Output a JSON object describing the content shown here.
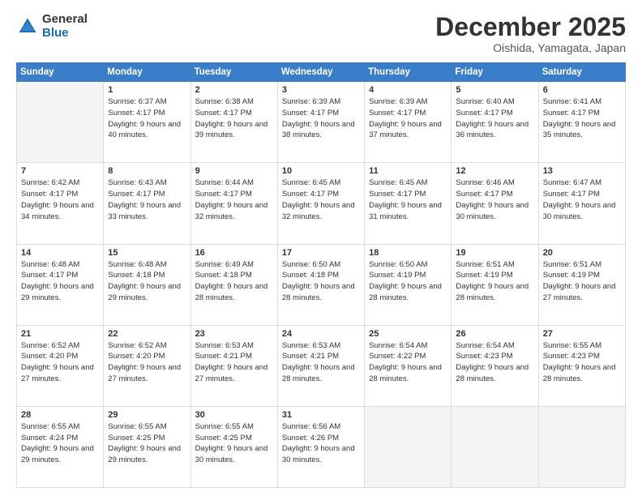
{
  "logo": {
    "general": "General",
    "blue": "Blue"
  },
  "header": {
    "month": "December 2025",
    "location": "Oishida, Yamagata, Japan"
  },
  "days_of_week": [
    "Sunday",
    "Monday",
    "Tuesday",
    "Wednesday",
    "Thursday",
    "Friday",
    "Saturday"
  ],
  "weeks": [
    [
      {
        "day": "",
        "sunrise": "",
        "sunset": "",
        "daylight": ""
      },
      {
        "day": "1",
        "sunrise": "Sunrise: 6:37 AM",
        "sunset": "Sunset: 4:17 PM",
        "daylight": "Daylight: 9 hours and 40 minutes."
      },
      {
        "day": "2",
        "sunrise": "Sunrise: 6:38 AM",
        "sunset": "Sunset: 4:17 PM",
        "daylight": "Daylight: 9 hours and 39 minutes."
      },
      {
        "day": "3",
        "sunrise": "Sunrise: 6:39 AM",
        "sunset": "Sunset: 4:17 PM",
        "daylight": "Daylight: 9 hours and 38 minutes."
      },
      {
        "day": "4",
        "sunrise": "Sunrise: 6:39 AM",
        "sunset": "Sunset: 4:17 PM",
        "daylight": "Daylight: 9 hours and 37 minutes."
      },
      {
        "day": "5",
        "sunrise": "Sunrise: 6:40 AM",
        "sunset": "Sunset: 4:17 PM",
        "daylight": "Daylight: 9 hours and 36 minutes."
      },
      {
        "day": "6",
        "sunrise": "Sunrise: 6:41 AM",
        "sunset": "Sunset: 4:17 PM",
        "daylight": "Daylight: 9 hours and 35 minutes."
      }
    ],
    [
      {
        "day": "7",
        "sunrise": "Sunrise: 6:42 AM",
        "sunset": "Sunset: 4:17 PM",
        "daylight": "Daylight: 9 hours and 34 minutes."
      },
      {
        "day": "8",
        "sunrise": "Sunrise: 6:43 AM",
        "sunset": "Sunset: 4:17 PM",
        "daylight": "Daylight: 9 hours and 33 minutes."
      },
      {
        "day": "9",
        "sunrise": "Sunrise: 6:44 AM",
        "sunset": "Sunset: 4:17 PM",
        "daylight": "Daylight: 9 hours and 32 minutes."
      },
      {
        "day": "10",
        "sunrise": "Sunrise: 6:45 AM",
        "sunset": "Sunset: 4:17 PM",
        "daylight": "Daylight: 9 hours and 32 minutes."
      },
      {
        "day": "11",
        "sunrise": "Sunrise: 6:45 AM",
        "sunset": "Sunset: 4:17 PM",
        "daylight": "Daylight: 9 hours and 31 minutes."
      },
      {
        "day": "12",
        "sunrise": "Sunrise: 6:46 AM",
        "sunset": "Sunset: 4:17 PM",
        "daylight": "Daylight: 9 hours and 30 minutes."
      },
      {
        "day": "13",
        "sunrise": "Sunrise: 6:47 AM",
        "sunset": "Sunset: 4:17 PM",
        "daylight": "Daylight: 9 hours and 30 minutes."
      }
    ],
    [
      {
        "day": "14",
        "sunrise": "Sunrise: 6:48 AM",
        "sunset": "Sunset: 4:17 PM",
        "daylight": "Daylight: 9 hours and 29 minutes."
      },
      {
        "day": "15",
        "sunrise": "Sunrise: 6:48 AM",
        "sunset": "Sunset: 4:18 PM",
        "daylight": "Daylight: 9 hours and 29 minutes."
      },
      {
        "day": "16",
        "sunrise": "Sunrise: 6:49 AM",
        "sunset": "Sunset: 4:18 PM",
        "daylight": "Daylight: 9 hours and 28 minutes."
      },
      {
        "day": "17",
        "sunrise": "Sunrise: 6:50 AM",
        "sunset": "Sunset: 4:18 PM",
        "daylight": "Daylight: 9 hours and 28 minutes."
      },
      {
        "day": "18",
        "sunrise": "Sunrise: 6:50 AM",
        "sunset": "Sunset: 4:19 PM",
        "daylight": "Daylight: 9 hours and 28 minutes."
      },
      {
        "day": "19",
        "sunrise": "Sunrise: 6:51 AM",
        "sunset": "Sunset: 4:19 PM",
        "daylight": "Daylight: 9 hours and 28 minutes."
      },
      {
        "day": "20",
        "sunrise": "Sunrise: 6:51 AM",
        "sunset": "Sunset: 4:19 PM",
        "daylight": "Daylight: 9 hours and 27 minutes."
      }
    ],
    [
      {
        "day": "21",
        "sunrise": "Sunrise: 6:52 AM",
        "sunset": "Sunset: 4:20 PM",
        "daylight": "Daylight: 9 hours and 27 minutes."
      },
      {
        "day": "22",
        "sunrise": "Sunrise: 6:52 AM",
        "sunset": "Sunset: 4:20 PM",
        "daylight": "Daylight: 9 hours and 27 minutes."
      },
      {
        "day": "23",
        "sunrise": "Sunrise: 6:53 AM",
        "sunset": "Sunset: 4:21 PM",
        "daylight": "Daylight: 9 hours and 27 minutes."
      },
      {
        "day": "24",
        "sunrise": "Sunrise: 6:53 AM",
        "sunset": "Sunset: 4:21 PM",
        "daylight": "Daylight: 9 hours and 28 minutes."
      },
      {
        "day": "25",
        "sunrise": "Sunrise: 6:54 AM",
        "sunset": "Sunset: 4:22 PM",
        "daylight": "Daylight: 9 hours and 28 minutes."
      },
      {
        "day": "26",
        "sunrise": "Sunrise: 6:54 AM",
        "sunset": "Sunset: 4:23 PM",
        "daylight": "Daylight: 9 hours and 28 minutes."
      },
      {
        "day": "27",
        "sunrise": "Sunrise: 6:55 AM",
        "sunset": "Sunset: 4:23 PM",
        "daylight": "Daylight: 9 hours and 28 minutes."
      }
    ],
    [
      {
        "day": "28",
        "sunrise": "Sunrise: 6:55 AM",
        "sunset": "Sunset: 4:24 PM",
        "daylight": "Daylight: 9 hours and 29 minutes."
      },
      {
        "day": "29",
        "sunrise": "Sunrise: 6:55 AM",
        "sunset": "Sunset: 4:25 PM",
        "daylight": "Daylight: 9 hours and 29 minutes."
      },
      {
        "day": "30",
        "sunrise": "Sunrise: 6:55 AM",
        "sunset": "Sunset: 4:25 PM",
        "daylight": "Daylight: 9 hours and 30 minutes."
      },
      {
        "day": "31",
        "sunrise": "Sunrise: 6:56 AM",
        "sunset": "Sunset: 4:26 PM",
        "daylight": "Daylight: 9 hours and 30 minutes."
      },
      {
        "day": "",
        "sunrise": "",
        "sunset": "",
        "daylight": ""
      },
      {
        "day": "",
        "sunrise": "",
        "sunset": "",
        "daylight": ""
      },
      {
        "day": "",
        "sunrise": "",
        "sunset": "",
        "daylight": ""
      }
    ]
  ]
}
